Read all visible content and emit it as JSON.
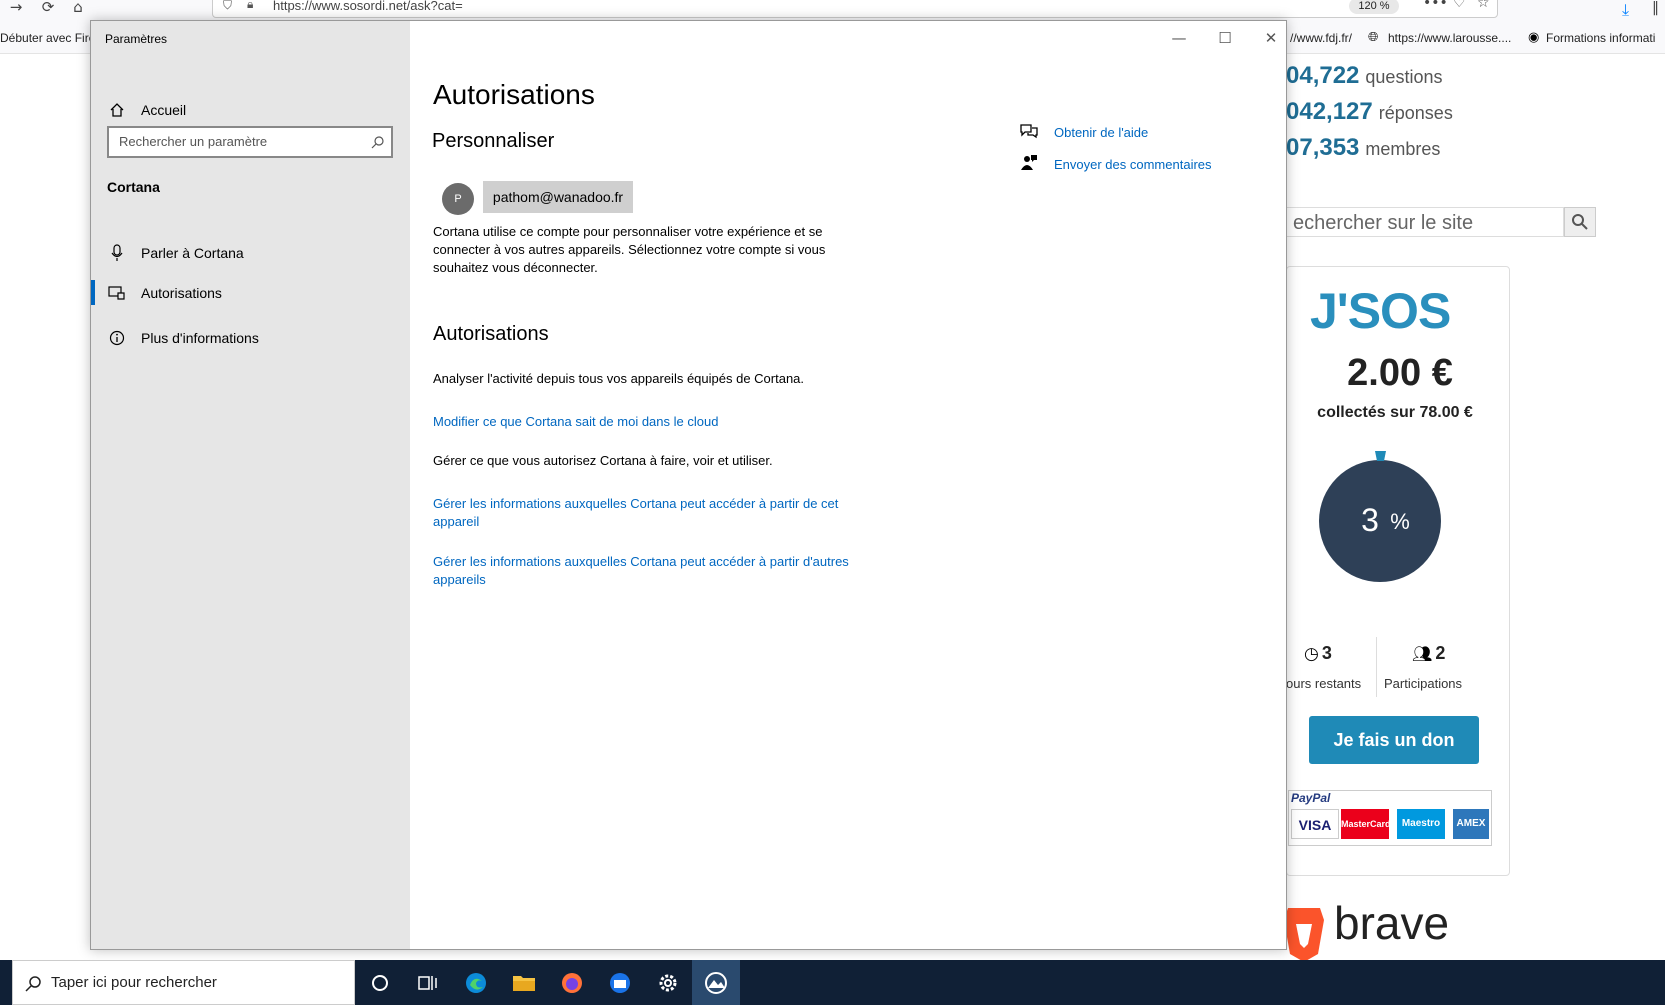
{
  "browser": {
    "url": "https://www.sosordi.net/ask?cat=",
    "zoom": "120 %",
    "bookmarks": [
      "Débuter avec Firef",
      "//www.fdj.fr/",
      "https://www.larousse....",
      "Formations informati"
    ]
  },
  "site": {
    "stats": [
      {
        "num": "04,722",
        "label": "questions"
      },
      {
        "num": "042,127",
        "label": "réponses"
      },
      {
        "num": "07,353",
        "label": "membres"
      }
    ],
    "search_placeholder": "echercher sur le site",
    "donation": {
      "logo": "J'SOS",
      "amount": "2.00 €",
      "collected": "collectés sur 78.00 €",
      "percent": "3",
      "percent_sign": "%",
      "percent_value": 0.03,
      "days_num": "3",
      "days_label": "ours restants",
      "participations_num": "2",
      "participations_label": "Participations",
      "button": "Je fais un don",
      "paypal": "PayPal",
      "cards": [
        "VISA",
        "MasterCard",
        "Maestro",
        "AMEX"
      ]
    },
    "brave": "brave"
  },
  "settings": {
    "window_title": "Paramètres",
    "sidebar": {
      "home": "Accueil",
      "search_placeholder": "Rechercher un paramètre",
      "section": "Cortana",
      "items": [
        {
          "label": "Parler à Cortana",
          "icon": "microphone-icon"
        },
        {
          "label": "Autorisations",
          "icon": "permissions-icon",
          "active": true
        },
        {
          "label": "Plus d'informations",
          "icon": "info-icon"
        }
      ]
    },
    "main": {
      "title": "Autorisations",
      "personalize_heading": "Personnaliser",
      "avatar_letter": "P",
      "account": "pathom@wanadoo.fr",
      "account_desc": "Cortana utilise ce compte pour personnaliser votre expérience et se connecter à vos autres appareils. Sélectionnez votre compte si vous souhaitez vous déconnecter.",
      "permissions_heading": "Autorisations",
      "analyze_text": "Analyser l'activité depuis tous vos appareils équipés de Cortana.",
      "link_cloud": "Modifier ce que Cortana sait de moi dans le cloud",
      "manage_text": "Gérer ce que vous autorisez Cortana à faire, voir et utiliser.",
      "link_this_device": "Gérer les informations auxquelles Cortana peut accéder à partir de cet appareil",
      "link_other_devices": "Gérer les informations auxquelles Cortana peut accéder à partir d'autres appareils"
    },
    "help": {
      "get_help": "Obtenir de l'aide",
      "feedback": "Envoyer des commentaires"
    }
  },
  "taskbar": {
    "search_placeholder": "Taper ici pour rechercher"
  },
  "colors": {
    "accent": "#0067c0",
    "taskbar": "#102036",
    "donation_blue": "#1f8ab7",
    "gauge": "#2e4057"
  }
}
